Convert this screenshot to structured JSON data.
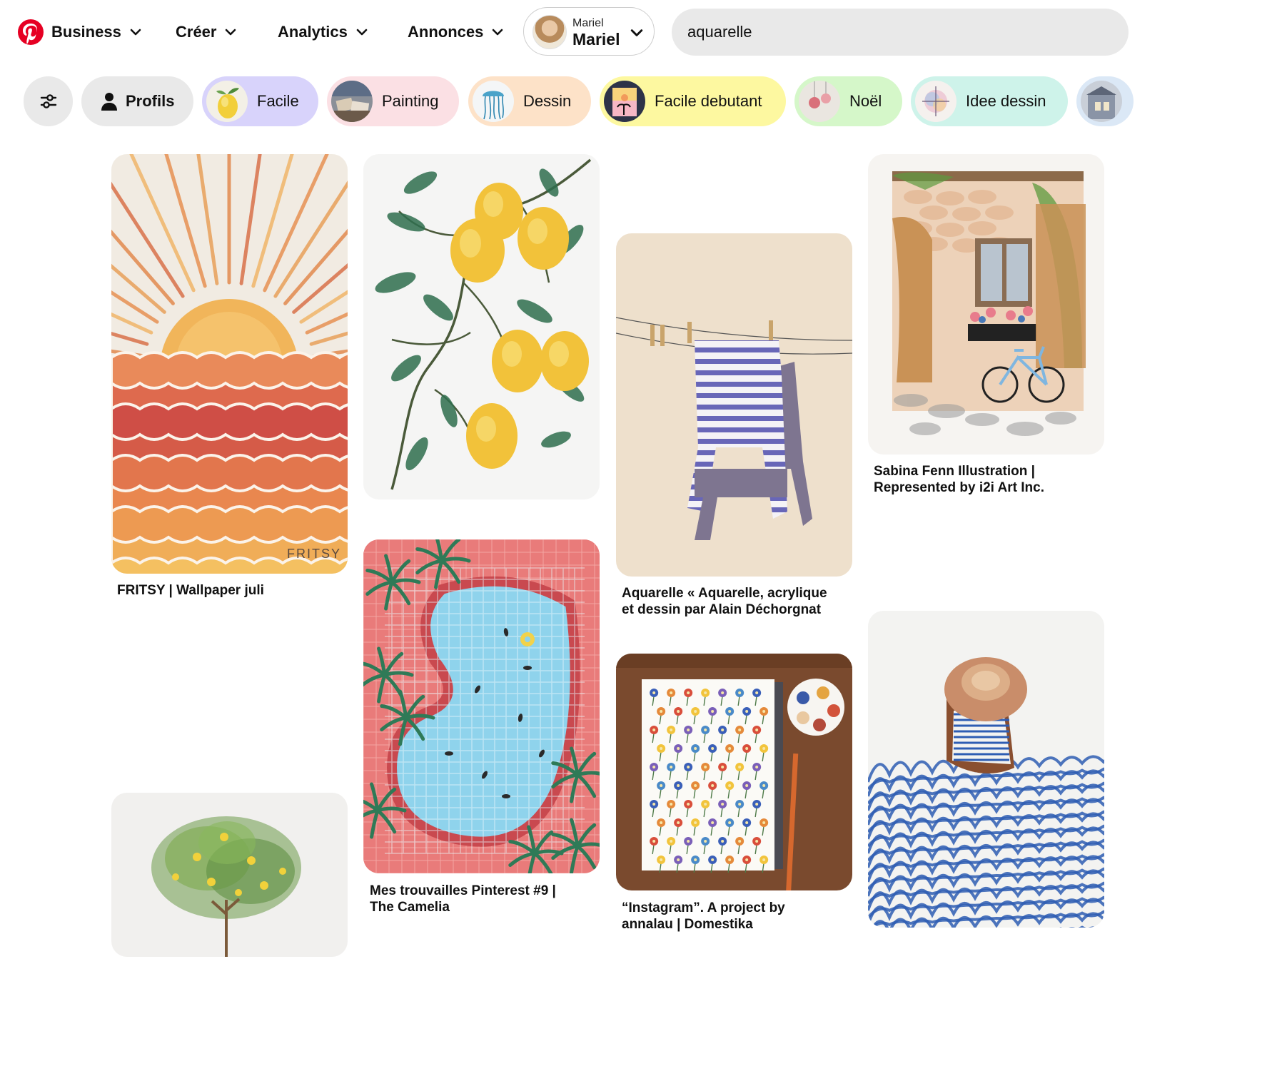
{
  "nav": {
    "logo_icon": "pinterest-logo",
    "business_label": "Business",
    "creer_label": "Créer",
    "analytics_label": "Analytics",
    "annonces_label": "Annonces"
  },
  "account": {
    "small_name": "Mariel",
    "big_name": "Mariel"
  },
  "search": {
    "value": "aquarelle"
  },
  "chips": {
    "profils": "Profils",
    "facile": "Facile",
    "painting": "Painting",
    "dessin": "Dessin",
    "facile_debutant": "Facile debutant",
    "noel": "Noël",
    "idee_dessin": "Idee dessin"
  },
  "pins": {
    "fritsy_caption": "FRITSY | Wallpaper juli",
    "fritsy_watermark": "FRITSY",
    "camelia_caption_1": "Mes trouvailles Pinterest #9 |",
    "camelia_caption_2": "The Camelia",
    "aquarelle_caption_1": "Aquarelle « Aquarelle, acrylique",
    "aquarelle_caption_2": "et dessin par Alain Déchorgnat",
    "instagram_caption_1": "“Instagram”. A project by",
    "instagram_caption_2": "annalau | Domestika",
    "sabina_caption_1": "Sabina Fenn Illustration |",
    "sabina_caption_2": "Represented by i2i Art Inc."
  },
  "colors": {
    "brand": "#e60023",
    "chip_facile": "#d8d3fb",
    "chip_painting": "#fbe0e4",
    "chip_dessin": "#fde2c8",
    "chip_facile_debutant": "#fdf8a0",
    "chip_noel": "#d5f7c9",
    "chip_idee_dessin": "#cef3ea"
  }
}
